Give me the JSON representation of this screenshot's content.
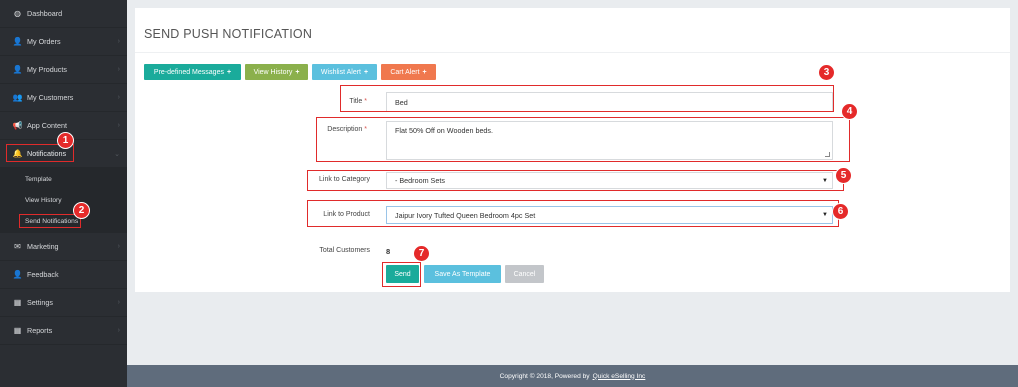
{
  "sidebar": {
    "items": [
      {
        "label": "Dashboard",
        "icon": "dashboard-icon",
        "glyph": "◍"
      },
      {
        "label": "My Orders",
        "icon": "user-icon",
        "glyph": "👤"
      },
      {
        "label": "My Products",
        "icon": "user-icon",
        "glyph": "👤"
      },
      {
        "label": "My Customers",
        "icon": "users-icon",
        "glyph": "👥"
      },
      {
        "label": "App Content",
        "icon": "megaphone-icon",
        "glyph": "📢"
      },
      {
        "label": "Notifications",
        "icon": "bell-icon",
        "glyph": "🔔"
      },
      {
        "label": "Marketing",
        "icon": "envelope-icon",
        "glyph": "✉"
      },
      {
        "label": "Feedback",
        "icon": "user-icon",
        "glyph": "👤"
      },
      {
        "label": "Settings",
        "icon": "grid-icon",
        "glyph": "▦"
      },
      {
        "label": "Reports",
        "icon": "grid-icon",
        "glyph": "▦"
      }
    ],
    "subitems": [
      "Template",
      "View History",
      "Send Notifications"
    ],
    "chevron": "›",
    "chevron_down": "⌄"
  },
  "main": {
    "title": "SEND PUSH NOTIFICATION",
    "buttons": {
      "predefined": "Pre-defined Messages",
      "view_history": "View History",
      "wishlist": "Wishlist Alert",
      "cart": "Cart Alert",
      "plus": "+"
    },
    "form": {
      "title_label": "Title",
      "title_value": "Bed",
      "description_label": "Description",
      "description_value": "Flat 50% Off on Wooden beds.",
      "category_label": "Link to Category",
      "category_value": "- Bedroom Sets",
      "product_label": "Link to Product",
      "product_value": "Jaipur Ivory Tufted Queen Bedroom 4pc Set",
      "required_mark": "*",
      "caret": "▼"
    },
    "total_customers_label": "Total Customers",
    "total_customers_value": "8",
    "send_label": "Send",
    "save_template_label": "Save As Template",
    "cancel_label": "Cancel"
  },
  "annotations": [
    "1",
    "2",
    "3",
    "4",
    "5",
    "6",
    "7"
  ],
  "footer": {
    "text": "Copyright © 2018, Powered by",
    "link": "Quick eSelling Inc"
  },
  "colors": {
    "teal": "#1aab9b",
    "green": "#8bb04c",
    "blue": "#5bc0de",
    "orange": "#f0784e",
    "cancel": "#c3c6ca",
    "annotation_red": "#e52a2a"
  }
}
